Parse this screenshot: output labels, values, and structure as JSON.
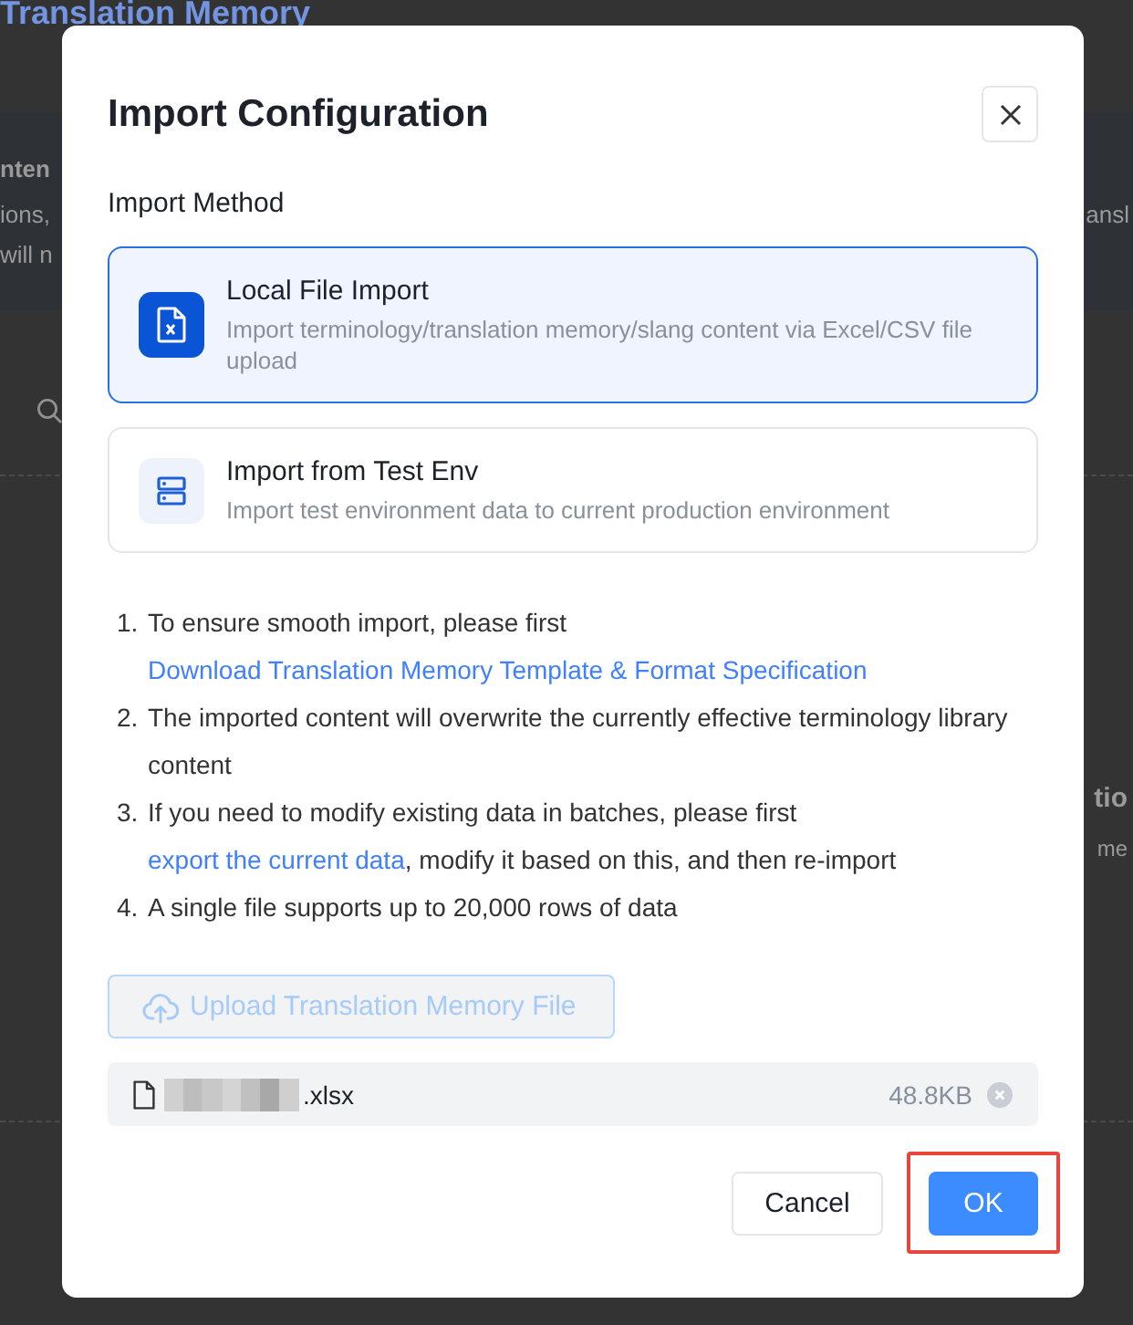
{
  "background": {
    "page_title": "Translation Memory",
    "notice": {
      "title": "nten",
      "lines": [
        "ions,",
        "will n"
      ],
      "right_text": "ansl"
    },
    "section": {
      "title": "tio",
      "text": "me"
    }
  },
  "dialog": {
    "title": "Import Configuration",
    "method_label": "Import Method",
    "methods": [
      {
        "kind": "local-file",
        "title": "Local File Import",
        "description": "Import terminology/translation memory/slang content via Excel/CSV file upload",
        "selected": true
      },
      {
        "kind": "test-env",
        "title": "Import from Test Env",
        "description": "Import test environment data to current production environment",
        "selected": false
      }
    ],
    "instructions": [
      {
        "number": "1.",
        "parts": [
          {
            "kind": "text",
            "text": "To ensure smooth import, please first "
          },
          {
            "kind": "link",
            "text": "Download Translation Memory Template & Format Specification"
          }
        ]
      },
      {
        "number": "2.",
        "parts": [
          {
            "kind": "text",
            "text": "The imported content will overwrite the currently effective terminology library content"
          }
        ]
      },
      {
        "number": "3.",
        "parts": [
          {
            "kind": "text",
            "text": "If you need to modify existing data in batches, please first "
          },
          {
            "kind": "link",
            "text": "export the current data"
          },
          {
            "kind": "text",
            "text": ", modify it based on this, and then re-import"
          }
        ]
      },
      {
        "number": "4.",
        "parts": [
          {
            "kind": "text",
            "text": "A single file supports up to 20,000 rows of data"
          }
        ]
      }
    ],
    "upload_button": {
      "label": "Upload Translation Memory File",
      "disabled": true
    },
    "files": [
      {
        "name": ".xlsx",
        "redacted": true,
        "size": "48.8KB"
      }
    ],
    "footer_buttons": [
      {
        "kind": "secondary",
        "label": "Cancel",
        "highlighted": false
      },
      {
        "kind": "primary",
        "label": "OK",
        "highlighted": true
      }
    ]
  }
}
